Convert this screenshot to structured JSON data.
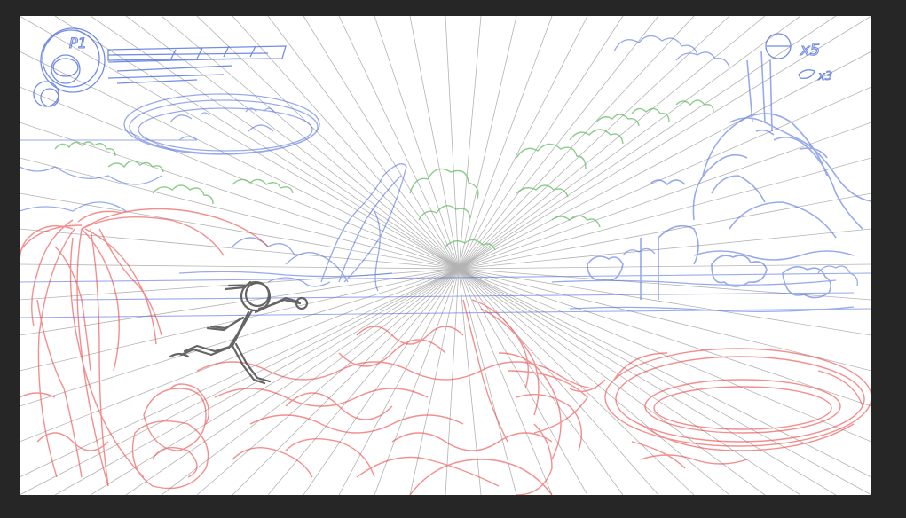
{
  "canvas": {
    "background": "#ffffff",
    "frame_color": "#262626"
  },
  "hud": {
    "player_label": "P1",
    "lives_label": "x5",
    "item_label": "x3"
  },
  "colors": {
    "foreground_sketch": "#ee4444",
    "midground_sketch": "#4466dd",
    "background_foliage": "#66bb66",
    "character_sketch": "#555555",
    "perspective_lines": "#999999"
  },
  "layers": [
    "perspective-grid",
    "background-foliage",
    "midground-blue",
    "foreground-red",
    "character"
  ],
  "scene_elements": {
    "hud_icons": [
      "player-portrait-icon",
      "health-bar-icon",
      "lives-icon",
      "item-icon"
    ],
    "midground": [
      "cloud-face",
      "castle-ruins",
      "left-cliffs",
      "right-bushes"
    ],
    "foreground": [
      "palm-tree",
      "rocks",
      "life-ring-float",
      "broken-boat"
    ],
    "character": "running-character"
  }
}
